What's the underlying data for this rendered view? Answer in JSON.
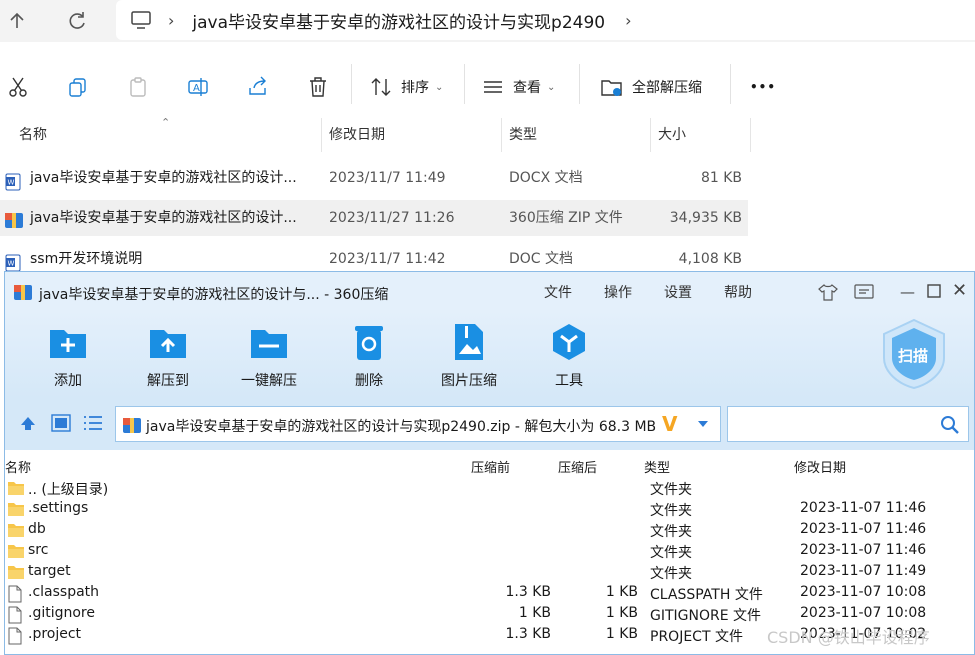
{
  "explorer": {
    "path": "java毕设安卓基于安卓的游戏社区的设计与实现p2490",
    "commands": {
      "sort": "排序",
      "view": "查看",
      "extract_all": "全部解压缩",
      "more": "•••"
    },
    "columns": {
      "name": "名称",
      "modified": "修改日期",
      "type": "类型",
      "size": "大小"
    },
    "files": [
      {
        "name": "java毕设安卓基于安卓的游戏社区的设计...",
        "modified": "2023/11/7 11:49",
        "type": "DOCX 文档",
        "size": "81 KB",
        "icon": "word-doc-icon"
      },
      {
        "name": "java毕设安卓基于安卓的游戏社区的设计...",
        "modified": "2023/11/27 11:26",
        "type": "360压缩 ZIP 文件",
        "size": "34,935 KB",
        "icon": "zip-archive-icon"
      },
      {
        "name": "ssm开发环境说明",
        "modified": "2023/11/7 11:42",
        "type": "DOC 文档",
        "size": "4,108 KB",
        "icon": "word-doc-icon"
      }
    ]
  },
  "zip": {
    "title": "java毕设安卓基于安卓的游戏社区的设计与... - 360压缩",
    "menu": {
      "file": "文件",
      "operate": "操作",
      "settings": "设置",
      "help": "帮助"
    },
    "toolbar": {
      "add": "添加",
      "extract_to": "解压到",
      "one_click_extract": "一键解压",
      "delete": "删除",
      "image_compress": "图片压缩",
      "tools": "工具",
      "scan": "扫描"
    },
    "address": "java毕设安卓基于安卓的游戏社区的设计与实现p2490.zip - 解包大小为 68.3 MB",
    "columns": {
      "name": "名称",
      "before": "压缩前",
      "after": "压缩后",
      "type": "类型",
      "modified": "修改日期"
    },
    "rows": [
      {
        "name": ".. (上级目录)",
        "before": "",
        "after": "",
        "type": "文件夹",
        "modified": "",
        "icon": "folder-icon"
      },
      {
        "name": ".settings",
        "before": "",
        "after": "",
        "type": "文件夹",
        "modified": "2023-11-07 11:46",
        "icon": "folder-icon"
      },
      {
        "name": "db",
        "before": "",
        "after": "",
        "type": "文件夹",
        "modified": "2023-11-07 11:46",
        "icon": "folder-icon"
      },
      {
        "name": "src",
        "before": "",
        "after": "",
        "type": "文件夹",
        "modified": "2023-11-07 11:46",
        "icon": "folder-icon"
      },
      {
        "name": "target",
        "before": "",
        "after": "",
        "type": "文件夹",
        "modified": "2023-11-07 11:49",
        "icon": "folder-icon"
      },
      {
        "name": ".classpath",
        "before": "1.3 KB",
        "after": "1 KB",
        "type": "CLASSPATH 文件",
        "modified": "2023-11-07 10:08",
        "icon": "file-icon"
      },
      {
        "name": ".gitignore",
        "before": "1 KB",
        "after": "1 KB",
        "type": "GITIGNORE 文件",
        "modified": "2023-11-07 10:08",
        "icon": "file-icon"
      },
      {
        "name": ".project",
        "before": "1.3 KB",
        "after": "1 KB",
        "type": "PROJECT 文件",
        "modified": "2023-11-07 10:02",
        "icon": "file-icon"
      }
    ]
  },
  "watermark": "CSDN @铁山毕设程序",
  "colors": {
    "accent": "#1a8fe3",
    "toolbar_bg": "#d5e8f8",
    "selected_row": "#f0f0f0",
    "folder": "#f7c64a"
  }
}
